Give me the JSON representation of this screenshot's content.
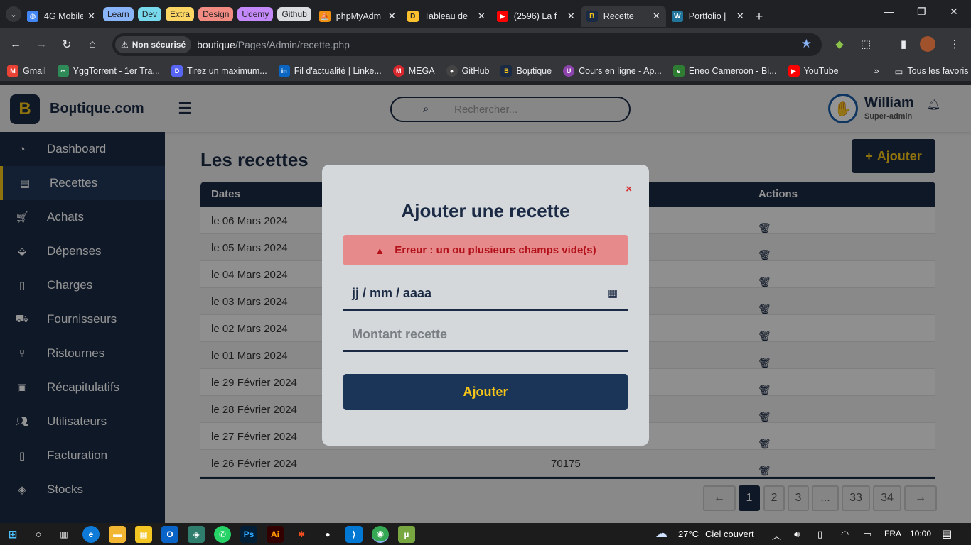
{
  "browser": {
    "tabs": [
      {
        "label": "4G Mobile",
        "icon": "globe-icon"
      },
      {
        "label": "phpMyAdm",
        "icon": "phpmyadmin-icon"
      },
      {
        "label": "Tableau de",
        "icon": "dashboard-icon"
      },
      {
        "label": "(2596) La f",
        "icon": "youtube-icon"
      },
      {
        "label": "Recette",
        "icon": "boutique-icon",
        "active": true
      },
      {
        "label": "Portfolio |",
        "icon": "wordpress-icon"
      }
    ],
    "groups": [
      {
        "label": "Learn",
        "color": "#8ab4f8"
      },
      {
        "label": "Dev",
        "color": "#78d9ec"
      },
      {
        "label": "Extra",
        "color": "#fdd663"
      },
      {
        "label": "Design",
        "color": "#f28b82"
      },
      {
        "label": "Udemy",
        "color": "#c58af9"
      },
      {
        "label": "Github",
        "color": "#dadce0"
      }
    ],
    "security_label": "Non sécurisé",
    "url_host": "boutique",
    "url_path": "/Pages/Admin/recette.php",
    "bookmarks": [
      {
        "label": "Gmail",
        "icon": "gmail-icon",
        "color": "#ea4335"
      },
      {
        "label": "YggTorrent - 1er Tra...",
        "icon": "ygg-icon",
        "color": "#2e8b57"
      },
      {
        "label": "Tirez un maximum...",
        "icon": "bookmark-icon",
        "color": "#5865f2"
      },
      {
        "label": "Fil d'actualité | Linke...",
        "icon": "linkedin-icon",
        "color": "#0a66c2"
      },
      {
        "label": "MEGA",
        "icon": "mega-icon",
        "color": "#d9272e"
      },
      {
        "label": "GitHub",
        "icon": "github-icon",
        "color": "#444444"
      },
      {
        "label": "Boµtique",
        "icon": "boutique-icon",
        "color": "#1b2a44"
      },
      {
        "label": "Cours en ligne - Ap...",
        "icon": "course-icon",
        "color": "#8e44ad"
      },
      {
        "label": "Eneo Cameroon - Bi...",
        "icon": "eneo-icon",
        "color": "#2e7d32"
      },
      {
        "label": "YouTube",
        "icon": "youtube-icon",
        "color": "#ff0000"
      }
    ],
    "all_bookmarks_label": "Tous les favoris"
  },
  "app": {
    "brand": "Boµtique.com",
    "search_placeholder": "Rechercher...",
    "user_name": "William",
    "user_role": "Super-admin",
    "sidebar": [
      {
        "label": "Dashboard",
        "icon": "dashboard-icon"
      },
      {
        "label": "Recettes",
        "icon": "recettes-icon",
        "active": true
      },
      {
        "label": "Achats",
        "icon": "cart-icon"
      },
      {
        "label": "Dépenses",
        "icon": "expenses-icon"
      },
      {
        "label": "Charges",
        "icon": "file-icon"
      },
      {
        "label": "Fournisseurs",
        "icon": "truck-icon"
      },
      {
        "label": "Ristournes",
        "icon": "ristourne-icon"
      },
      {
        "label": "Récapitulatifs",
        "icon": "clipboard-icon"
      },
      {
        "label": "Utilisateurs",
        "icon": "users-icon"
      },
      {
        "label": "Facturation",
        "icon": "invoice-icon"
      },
      {
        "label": "Stocks",
        "icon": "layers-icon"
      }
    ],
    "page_title": "Les recettes",
    "add_button": "Ajouter",
    "table": {
      "columns": [
        "Dates",
        "Actions"
      ],
      "rows": [
        {
          "date": "le 06 Mars 2024",
          "amount": ""
        },
        {
          "date": "le 05 Mars 2024",
          "amount": ""
        },
        {
          "date": "le 04 Mars 2024",
          "amount": ""
        },
        {
          "date": "le 03 Mars 2024",
          "amount": ""
        },
        {
          "date": "le 02 Mars 2024",
          "amount": ""
        },
        {
          "date": "le 01 Mars 2024",
          "amount": ""
        },
        {
          "date": "le 29 Février 2024",
          "amount": ""
        },
        {
          "date": "le 28 Février 2024",
          "amount": ""
        },
        {
          "date": "le 27 Février 2024",
          "amount": ""
        },
        {
          "date": "le 26 Février 2024",
          "amount": "70175"
        }
      ]
    },
    "pagination": [
      "←",
      "1",
      "2",
      "3",
      "...",
      "33",
      "34",
      "→"
    ],
    "modal": {
      "close": "×",
      "title": "Ajouter une recette",
      "error": "Erreur : un ou plusieurs champs vide(s)",
      "date_placeholder": "jj / mm / aaaa",
      "amount_placeholder": "Montant recette",
      "submit": "Ajouter"
    }
  },
  "taskbar": {
    "temperature": "27°C",
    "weather": "Ciel couvert",
    "language": "FRA",
    "time": "10:00"
  }
}
